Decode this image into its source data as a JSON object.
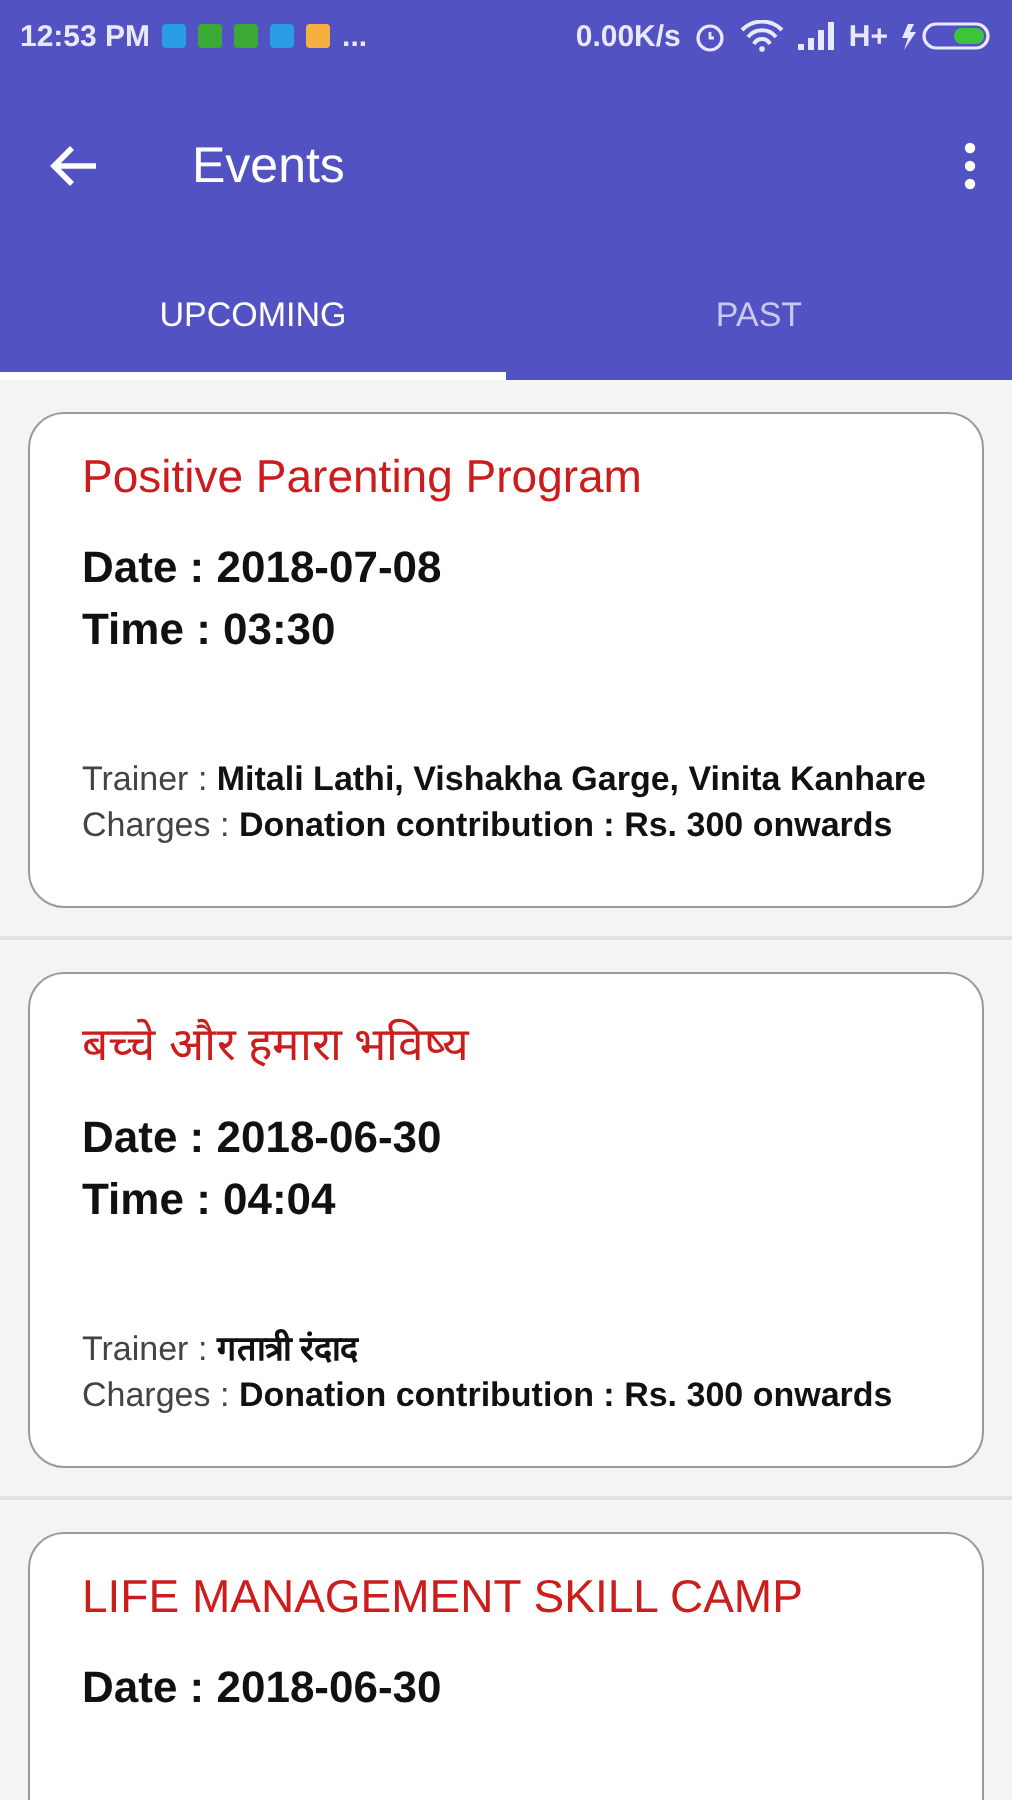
{
  "status_bar": {
    "time": "12:53 PM",
    "more": "...",
    "speed": "0.00K/s",
    "network": "H+"
  },
  "app_bar": {
    "title": "Events"
  },
  "tabs": [
    {
      "label": "UPCOMING",
      "selected": true
    },
    {
      "label": "PAST",
      "selected": false
    }
  ],
  "events": [
    {
      "title": "Positive Parenting Program",
      "date": "Date : 2018-07-08",
      "time": "Time : 03:30",
      "trainer_label": "Trainer : ",
      "trainer": "Mitali Lathi, Vishakha Garge, Vinita Kanhare",
      "charges_label": "Charges : ",
      "charges": "Donation contribution : Rs. 300 onwards"
    },
    {
      "title": "बच्चे और हमारा भविष्य",
      "date": "Date : 2018-06-30",
      "time": "Time : 04:04",
      "trainer_label": "Trainer : ",
      "trainer": "गतात्री रंदाद",
      "charges_label": "Charges : ",
      "charges": "Donation contribution : Rs. 300 onwards"
    },
    {
      "title": "LIFE MANAGEMENT SKILL CAMP",
      "date": "Date : 2018-06-30"
    }
  ]
}
